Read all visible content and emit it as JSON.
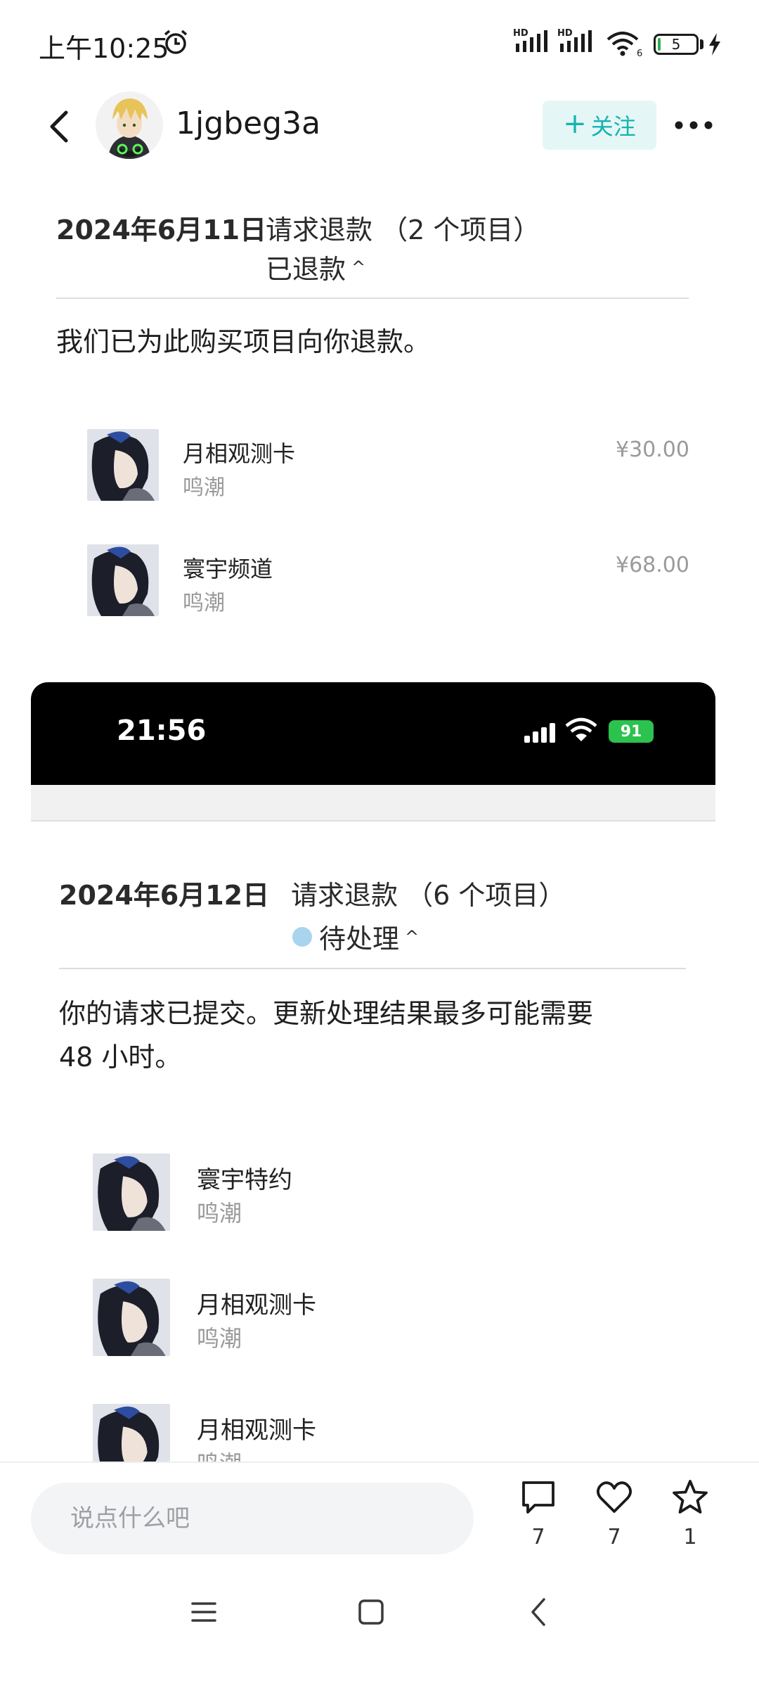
{
  "status_bar": {
    "time": "上午10:25",
    "signal_label_1": "HD",
    "signal_label_2": "HD",
    "wifi_label": "6",
    "battery": "5"
  },
  "header": {
    "username": "1jgbeg3a",
    "follow_label": "关注"
  },
  "refund_1": {
    "date": "2024年6月11日",
    "request": "请求退款 （2 个项目）",
    "status": "已退款",
    "message": "我们已为此购买项目向你退款。",
    "items": [
      {
        "name": "月相观测卡",
        "game": "鸣潮",
        "price": "¥30.00"
      },
      {
        "name": "寰宇频道",
        "game": "鸣潮",
        "price": "¥68.00"
      }
    ]
  },
  "ios_overlay": {
    "time": "21:56",
    "battery": "91"
  },
  "refund_2": {
    "date": "2024年6月12日",
    "request": "请求退款 （6 个项目）",
    "status": "待处理",
    "message_line1": "你的请求已提交。更新处理结果最多可能需要",
    "message_line2": "48 小时。",
    "items": [
      {
        "name": "寰宇特约",
        "game": "鸣潮"
      },
      {
        "name": "月相观测卡",
        "game": "鸣潮"
      },
      {
        "name": "月相观测卡",
        "game": "鸣潮"
      }
    ]
  },
  "bottom_bar": {
    "placeholder": "说点什么吧",
    "comment_count": "7",
    "like_count": "7",
    "star_count": "1"
  },
  "colors": {
    "accent": "#16b3b1",
    "pending_dot": "#a9d4ee",
    "ios_battery": "#2bc24e"
  }
}
